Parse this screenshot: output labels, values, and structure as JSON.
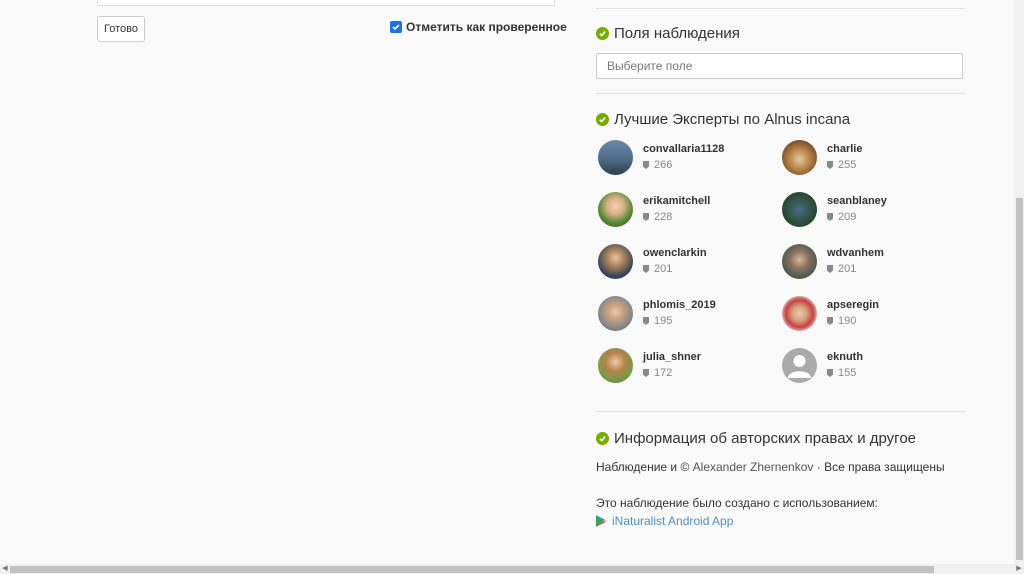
{
  "form": {
    "done_label": "Готово",
    "reviewed_label": "Отметить как проверенное",
    "reviewed_checked": true
  },
  "observation_fields": {
    "title": "Поля наблюдения",
    "select_placeholder": "Выберите поле"
  },
  "top_experts": {
    "title_prefix": "Лучшие Эксперты по",
    "taxon": "Alnus incana",
    "experts": [
      {
        "name": "convallaria1128",
        "count": "266"
      },
      {
        "name": "charlie",
        "count": "255"
      },
      {
        "name": "erikamitchell",
        "count": "228"
      },
      {
        "name": "seanblaney",
        "count": "209"
      },
      {
        "name": "owenclarkin",
        "count": "201"
      },
      {
        "name": "wdvanhem",
        "count": "201"
      },
      {
        "name": "phlomis_2019",
        "count": "195"
      },
      {
        "name": "apseregin",
        "count": "190"
      },
      {
        "name": "julia_shner",
        "count": "172"
      },
      {
        "name": "eknuth",
        "count": "155"
      }
    ]
  },
  "copyright": {
    "title": "Информация об авторских правах и другое",
    "line_prefix": "Наблюдение и ©",
    "author": "Alexander Zhernenkov",
    "line_suffix": "· Все права защищены",
    "created_with": "Это наблюдение было создано с использованием:",
    "app_name": "iNaturalist Android App"
  },
  "colors": {
    "accent_green": "#74ac00",
    "link_blue": "#4a90c2",
    "checkbox_blue": "#1a73e8"
  }
}
